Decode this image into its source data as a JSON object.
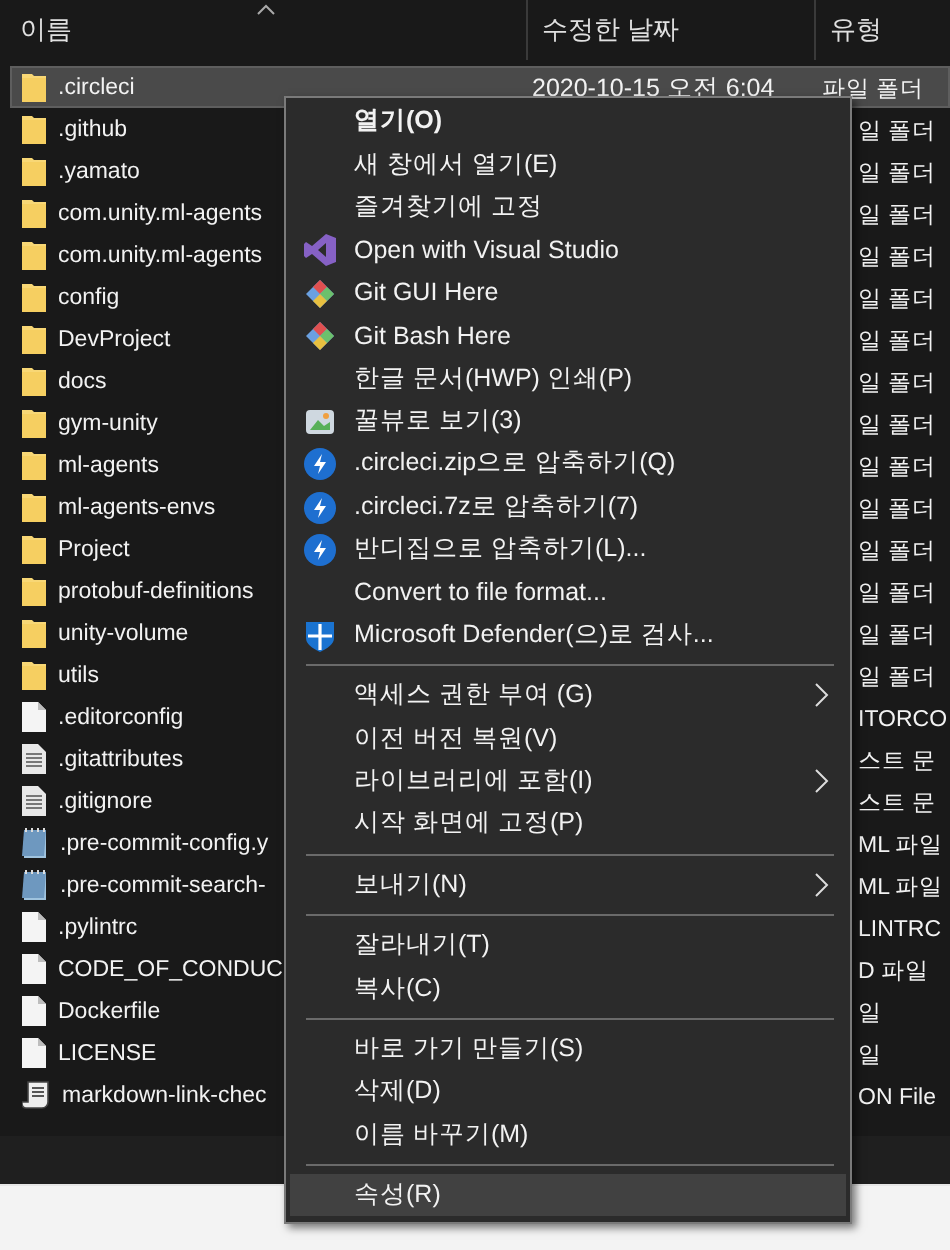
{
  "columns": [
    {
      "label": "이름"
    },
    {
      "label": "수정한 날짜"
    },
    {
      "label": "유형"
    }
  ],
  "rows": [
    {
      "name": ".circleci",
      "kind": "folder",
      "date": "2020-10-15 오전 6:04",
      "type": "파일 폴더",
      "selected": true
    },
    {
      "name": ".github",
      "kind": "folder",
      "type": "일 폴더",
      "selected": false
    },
    {
      "name": ".yamato",
      "kind": "folder",
      "type": "일 폴더",
      "selected": false
    },
    {
      "name": "com.unity.ml-agents",
      "kind": "folder",
      "type": "일 폴더",
      "selected": false
    },
    {
      "name": "com.unity.ml-agents",
      "kind": "folder",
      "type": "일 폴더",
      "selected": false
    },
    {
      "name": "config",
      "kind": "folder",
      "type": "일 폴더",
      "selected": false
    },
    {
      "name": "DevProject",
      "kind": "folder",
      "type": "일 폴더",
      "selected": false
    },
    {
      "name": "docs",
      "kind": "folder",
      "type": "일 폴더",
      "selected": false
    },
    {
      "name": "gym-unity",
      "kind": "folder",
      "type": "일 폴더",
      "selected": false
    },
    {
      "name": "ml-agents",
      "kind": "folder",
      "type": "일 폴더",
      "selected": false
    },
    {
      "name": "ml-agents-envs",
      "kind": "folder",
      "type": "일 폴더",
      "selected": false
    },
    {
      "name": "Project",
      "kind": "folder",
      "type": "일 폴더",
      "selected": false
    },
    {
      "name": "protobuf-definitions",
      "kind": "folder",
      "type": "일 폴더",
      "selected": false
    },
    {
      "name": "unity-volume",
      "kind": "folder",
      "type": "일 폴더",
      "selected": false
    },
    {
      "name": "utils",
      "kind": "folder",
      "type": "일 폴더",
      "selected": false
    },
    {
      "name": ".editorconfig",
      "kind": "file",
      "type": "ITORCO",
      "selected": false
    },
    {
      "name": ".gitattributes",
      "kind": "text",
      "type": "스트 문",
      "selected": false
    },
    {
      "name": ".gitignore",
      "kind": "text",
      "type": "스트 문",
      "selected": false
    },
    {
      "name": ".pre-commit-config.y",
      "kind": "notepad",
      "type": "ML 파일",
      "selected": false
    },
    {
      "name": ".pre-commit-search-",
      "kind": "notepad",
      "type": "ML 파일",
      "selected": false
    },
    {
      "name": ".pylintrc",
      "kind": "file",
      "type": "LINTRC",
      "selected": false
    },
    {
      "name": "CODE_OF_CONDUC",
      "kind": "file",
      "type": "D 파일",
      "selected": false
    },
    {
      "name": "Dockerfile",
      "kind": "file",
      "type": "일",
      "selected": false
    },
    {
      "name": "LICENSE",
      "kind": "file",
      "type": "일",
      "selected": false
    },
    {
      "name": "markdown-link-chec",
      "kind": "script",
      "type": "ON File",
      "selected": false
    }
  ],
  "context_menu": [
    {
      "kind": "item",
      "label": "열기(O)",
      "bold": true,
      "selected": false
    },
    {
      "kind": "item",
      "label": "새 창에서 열기(E)",
      "selected": false
    },
    {
      "kind": "item",
      "label": "즐겨찾기에 고정",
      "selected": false
    },
    {
      "kind": "visual_studio",
      "label": "Open with Visual Studio",
      "selected": false
    },
    {
      "kind": "git",
      "label": "Git GUI Here",
      "selected": false
    },
    {
      "kind": "git",
      "label": "Git Bash Here",
      "selected": false
    },
    {
      "kind": "item",
      "label": "한글 문서(HWP) 인쇄(P)",
      "selected": false
    },
    {
      "kind": "viewer",
      "label": "꿀뷰로 보기(3)",
      "selected": false
    },
    {
      "kind": "archive",
      "label": ".circleci.zip으로 압축하기(Q)",
      "selected": false
    },
    {
      "kind": "archive",
      "label": ".circleci.7z로 압축하기(7)",
      "selected": false
    },
    {
      "kind": "archive",
      "label": "반디집으로 압축하기(L)...",
      "selected": false
    },
    {
      "kind": "item",
      "label": "Convert to file format...",
      "selected": false
    },
    {
      "kind": "defender",
      "label": "Microsoft Defender(으)로 검사...",
      "selected": false
    },
    {
      "kind": "separator"
    },
    {
      "kind": "item",
      "label": "액세스 권한 부여 (G)",
      "submenu": true,
      "selected": false
    },
    {
      "kind": "item",
      "label": "이전 버전 복원(V)",
      "selected": false
    },
    {
      "kind": "item",
      "label": "라이브러리에 포함(I)",
      "submenu": true,
      "selected": false
    },
    {
      "kind": "item",
      "label": "시작 화면에 고정(P)",
      "selected": false
    },
    {
      "kind": "separator"
    },
    {
      "kind": "item",
      "label": "보내기(N)",
      "submenu": true,
      "selected": false
    },
    {
      "kind": "separator"
    },
    {
      "kind": "item",
      "label": "잘라내기(T)",
      "selected": false
    },
    {
      "kind": "item",
      "label": "복사(C)",
      "selected": false
    },
    {
      "kind": "separator"
    },
    {
      "kind": "item",
      "label": "바로 가기 만들기(S)",
      "selected": false
    },
    {
      "kind": "item",
      "label": "삭제(D)",
      "selected": false
    },
    {
      "kind": "item",
      "label": "이름 바꾸기(M)",
      "selected": false
    },
    {
      "kind": "separator"
    },
    {
      "kind": "item",
      "label": "속성(R)",
      "selected": true
    }
  ]
}
